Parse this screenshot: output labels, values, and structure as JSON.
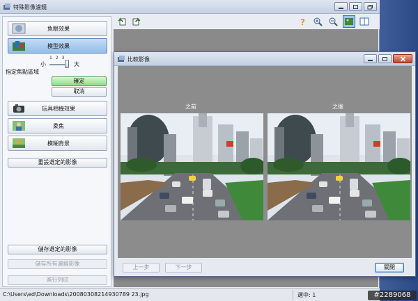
{
  "window": {
    "title": "特殊影像濾鏡"
  },
  "left_panel": {
    "effects": [
      {
        "label": "魚眼效果",
        "active": false
      },
      {
        "label": "模型效果",
        "active": true
      },
      {
        "label": "玩具相機效果",
        "active": false
      },
      {
        "label": "柔焦",
        "active": false
      },
      {
        "label": "模糊背景",
        "active": false
      }
    ],
    "slider": {
      "small_label": "小",
      "big_label": "大",
      "ticks": [
        "1",
        "2",
        "3"
      ],
      "value": 3,
      "max": 3
    },
    "focus_area_label": "指定焦點區域",
    "confirm_label": "確定",
    "cancel_label": "取消",
    "reset_label": "重設選定的影像",
    "save_selected_label": "儲存選定的影像",
    "save_all_label": "儲存所有濾鏡影像",
    "print_label": "進行列印"
  },
  "statusbar": {
    "path": "C:\\Users\\ed\\Downloads\\20080308214930789 23.jpg",
    "selected": "選中: 1"
  },
  "dialog": {
    "title": "比較影像",
    "before_label": "之前",
    "after_label": "之後",
    "prev_label": "上一步",
    "next_label": "下一步",
    "close_label": "關閉"
  },
  "watermark": "#2289068",
  "colors": {
    "accent": "#94bde8",
    "green": "#8fd98a",
    "close": "#c2452a"
  }
}
